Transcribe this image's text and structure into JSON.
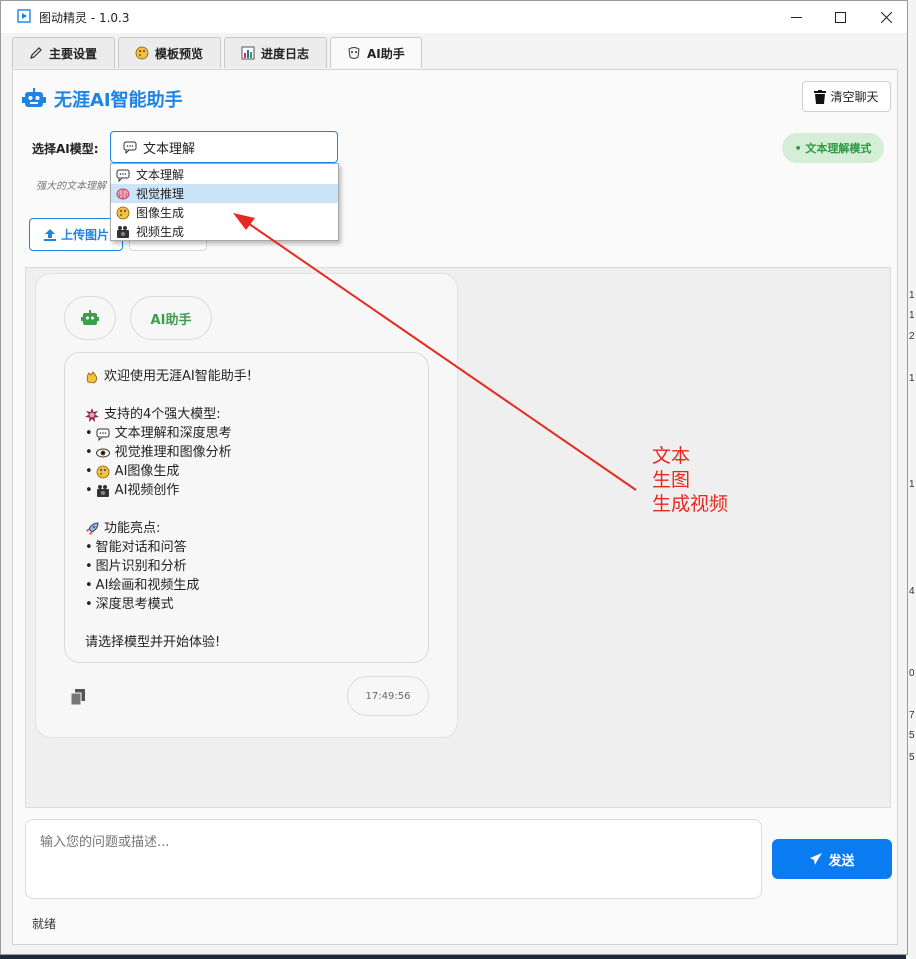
{
  "window": {
    "title": "图动精灵 - 1.0.3",
    "minimize": "—",
    "maximize": "☐",
    "close": "✕"
  },
  "tabs": [
    {
      "label": "主要设置",
      "icon": "pencil-icon"
    },
    {
      "label": "模板预览",
      "icon": "palette-icon"
    },
    {
      "label": "进度日志",
      "icon": "bar-chart-icon"
    },
    {
      "label": "AI助手",
      "icon": "robot-mask-icon",
      "active": true
    }
  ],
  "header": {
    "title": "无涯AI智能助手",
    "clear_button": "清空聊天"
  },
  "model": {
    "label": "选择AI模型:",
    "selected": "文本理解",
    "mode_badge": "• 文本理解模式",
    "description": "强大的文本理解",
    "options": [
      {
        "label": "文本理解",
        "icon": "speech-bubble-icon"
      },
      {
        "label": "视觉推理",
        "icon": "brain-icon",
        "highlighted": true
      },
      {
        "label": "图像生成",
        "icon": "palette-icon"
      },
      {
        "label": "视频生成",
        "icon": "camera-icon"
      }
    ]
  },
  "upload": {
    "label": "上传图片"
  },
  "message": {
    "sender": "AI助手",
    "time": "17:49:56",
    "lines": [
      {
        "icon": "clap-icon",
        "text": "欢迎使用无涯AI智能助手!"
      },
      {
        "gap": true
      },
      {
        "icon": "star-burst-icon",
        "text": "支持的4个强大模型:"
      },
      {
        "bullet": "•",
        "icon": "speech-bubble-icon",
        "text": "文本理解和深度思考"
      },
      {
        "bullet": "•",
        "icon": "eye-icon",
        "text": "视觉推理和图像分析"
      },
      {
        "bullet": "•",
        "icon": "palette-icon",
        "text": "AI图像生成"
      },
      {
        "bullet": "•",
        "icon": "camera-icon",
        "text": "AI视频创作"
      },
      {
        "gap": true
      },
      {
        "icon": "rocket-icon",
        "text": "功能亮点:"
      },
      {
        "bullet": "•",
        "text": "智能对话和问答"
      },
      {
        "bullet": "•",
        "text": "图片识别和分析"
      },
      {
        "bullet": "•",
        "text": "AI绘画和视频生成"
      },
      {
        "bullet": "•",
        "text": "深度思考模式"
      },
      {
        "gap": true
      },
      {
        "text": "请选择模型并开始体验!"
      }
    ]
  },
  "annotation": {
    "lines": [
      "文本",
      "生图",
      "生成视频"
    ],
    "color": "#e8291f"
  },
  "input": {
    "placeholder": "输入您的问题或描述..."
  },
  "send": {
    "label": "发送"
  },
  "status": "就绪",
  "side_numbers": [
    "1",
    "1",
    "2",
    "1",
    "1",
    "4",
    "0",
    "7",
    "5",
    "5"
  ],
  "colors": {
    "accent": "#1d84e6",
    "ai_green": "#3c9d4d",
    "send_blue": "#0a7cf2"
  }
}
